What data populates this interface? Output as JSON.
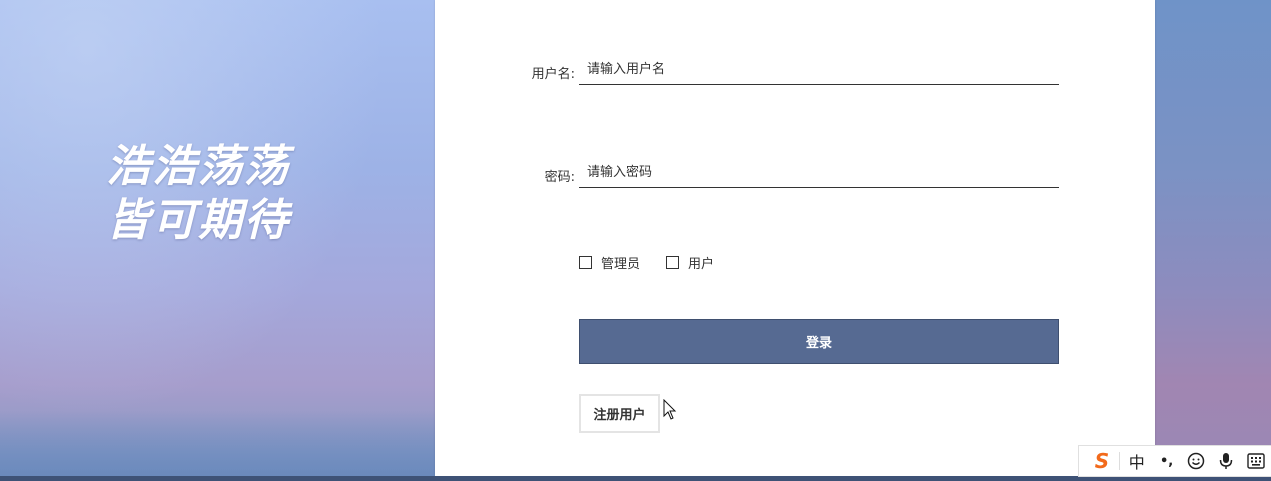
{
  "background": {
    "slogan_line1": "浩浩荡荡",
    "slogan_line2": "皆可期待"
  },
  "form": {
    "username_label": "用户名:",
    "username_placeholder": "请输入用户名",
    "password_label": "密码:",
    "password_placeholder": "请输入密码",
    "role_options": [
      {
        "label": "管理员",
        "checked": false
      },
      {
        "label": "用户",
        "checked": false
      }
    ],
    "login_label": "登录",
    "register_label": "注册用户"
  },
  "ime_toolbar": {
    "logo": "S",
    "mode": "中",
    "punctuation": "•,",
    "icons": [
      "sogou-logo-icon",
      "chinese-mode-icon",
      "punctuation-icon",
      "emoji-icon",
      "microphone-icon",
      "keyboard-icon"
    ]
  },
  "colors": {
    "login_button": "#566a92",
    "ime_logo": "#f26a1b"
  }
}
